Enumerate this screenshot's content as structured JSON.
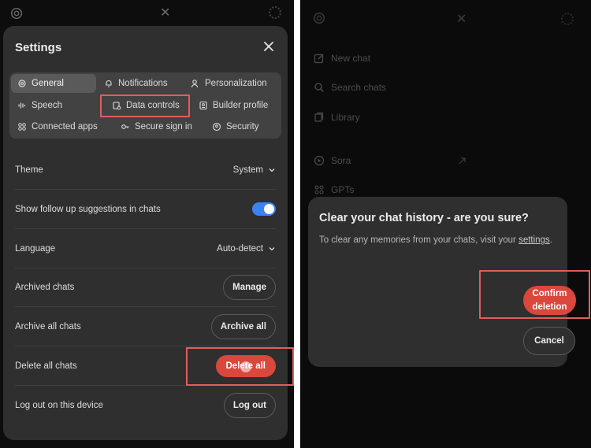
{
  "left": {
    "settings": {
      "title": "Settings",
      "tabs": [
        {
          "label": "General",
          "icon": "gear-icon"
        },
        {
          "label": "Notifications",
          "icon": "bell-icon"
        },
        {
          "label": "Personalization",
          "icon": "person-icon"
        },
        {
          "label": "Speech",
          "icon": "waveform-icon"
        },
        {
          "label": "Data controls",
          "icon": "database-icon"
        },
        {
          "label": "Builder profile",
          "icon": "id-card-icon"
        },
        {
          "label": "Connected apps",
          "icon": "apps-grid-icon"
        },
        {
          "label": "Secure sign in",
          "icon": "key-icon"
        },
        {
          "label": "Security",
          "icon": "shield-icon"
        }
      ],
      "active_tab": "General",
      "highlighted_tab": "Data controls",
      "rows": [
        {
          "label": "Theme",
          "value": "System"
        },
        {
          "label": "Show follow up suggestions in chats",
          "toggle_on": true
        },
        {
          "label": "Language",
          "value": "Auto-detect"
        },
        {
          "label": "Archived chats",
          "button": "Manage"
        },
        {
          "label": "Archive all chats",
          "button": "Archive all"
        },
        {
          "label": "Delete all chats",
          "button": "Delete all"
        },
        {
          "label": "Log out on this device",
          "button": "Log out"
        }
      ]
    }
  },
  "right": {
    "sidebar": {
      "items": [
        {
          "label": "New chat",
          "icon": "edit-icon"
        },
        {
          "label": "Search chats",
          "icon": "search-icon"
        },
        {
          "label": "Library",
          "icon": "library-icon"
        },
        {
          "label": "Sora",
          "icon": "play-circle-icon"
        },
        {
          "label": "GPTs",
          "icon": "apps-grid-icon"
        }
      ]
    },
    "dialog": {
      "title": "Clear your chat history - are you sure?",
      "body_prefix": "To clear any memories from your chats, visit your",
      "body_link": "settings",
      "body_suffix": ".",
      "confirm_line1": "Confirm",
      "confirm_line2": "deletion",
      "cancel": "Cancel"
    }
  },
  "colors": {
    "accent_red": "#d9473d",
    "highlight_red": "#e35d5d",
    "toggle_blue": "#3b82f6",
    "sheet_bg": "#2f2f2f"
  }
}
